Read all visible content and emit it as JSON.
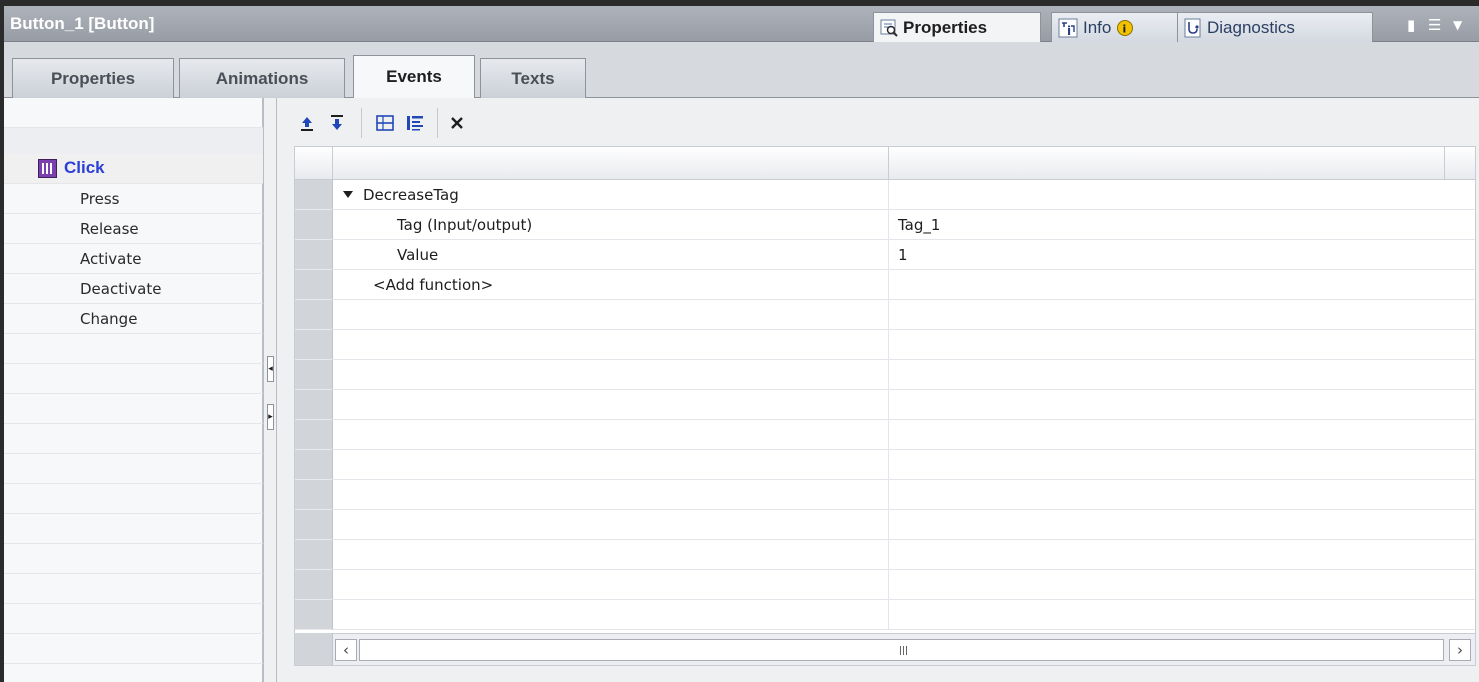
{
  "window": {
    "title": "Button_1 [Button]",
    "inspector_tabs": [
      {
        "label": "Properties",
        "icon": "properties-icon",
        "active": true
      },
      {
        "label": "Info",
        "icon": "info-icon",
        "badge_icon": "info-badge-icon"
      },
      {
        "label": "Diagnostics",
        "icon": "diagnostics-icon"
      }
    ]
  },
  "tabs": [
    {
      "label": "Properties"
    },
    {
      "label": "Animations"
    },
    {
      "label": "Events",
      "active": true
    },
    {
      "label": "Texts"
    }
  ],
  "events": [
    {
      "label": "Click",
      "selected": true,
      "icon": "event-click-icon"
    },
    {
      "label": "Press"
    },
    {
      "label": "Release"
    },
    {
      "label": "Activate"
    },
    {
      "label": "Deactivate"
    },
    {
      "label": "Change"
    }
  ],
  "toolbar": {
    "buttons": [
      "move-up-icon",
      "move-down-icon",
      "expand-all-icon",
      "collapse-all-icon",
      "delete-icon"
    ]
  },
  "function_list": {
    "rows": [
      {
        "name": "DecreaseTag",
        "value": "",
        "expanded": true
      },
      {
        "name": "Tag (Input/output)",
        "value": "Tag_1"
      },
      {
        "name": "Value",
        "value": "1"
      },
      {
        "name": "<Add function>",
        "value": ""
      }
    ]
  },
  "colors": {
    "accent_selected_text": "#2b3ed8",
    "title_bar": "#a3a8b0"
  }
}
